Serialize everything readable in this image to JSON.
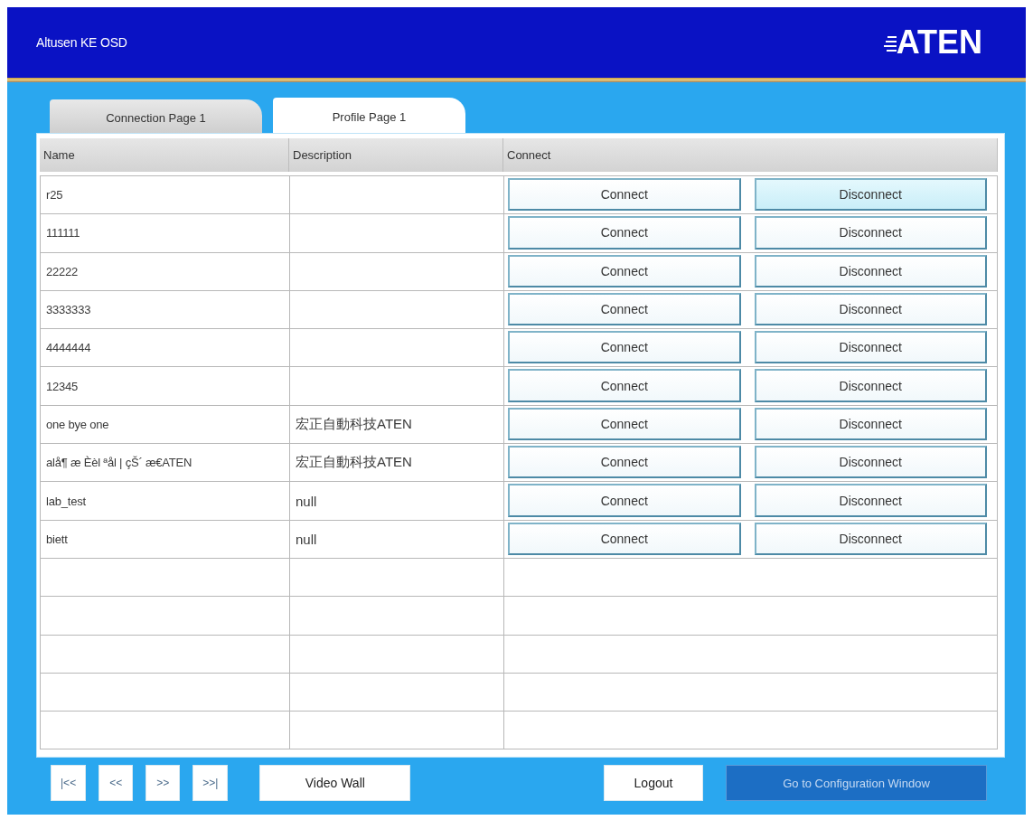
{
  "window": {
    "title": "Altusen KE OSD",
    "logo": "ATEN"
  },
  "tabs": [
    {
      "label": "Connection Page 1",
      "selected": false
    },
    {
      "label": "Profile Page 1",
      "selected": true
    }
  ],
  "table": {
    "columns": [
      "Name",
      "Description",
      "Connect"
    ],
    "rows": [
      {
        "name": "r25",
        "actions": [
          {
            "label": "Connect",
            "highlighted": false
          },
          {
            "label": "Disconnect",
            "highlighted": true
          }
        ]
      },
      {
        "name": "111111",
        "actions": [
          {
            "label": "Connect",
            "highlighted": false
          },
          {
            "label": "Disconnect",
            "highlighted": false
          }
        ]
      },
      {
        "name": "22222",
        "actions": [
          {
            "label": "Connect",
            "highlighted": false
          },
          {
            "label": "Disconnect",
            "highlighted": false
          }
        ]
      },
      {
        "name": "3333333",
        "actions": [
          {
            "label": "Connect",
            "highlighted": false
          },
          {
            "label": "Disconnect",
            "highlighted": false
          }
        ]
      },
      {
        "name": "4444444",
        "actions": [
          {
            "label": "Connect",
            "highlighted": false
          },
          {
            "label": "Disconnect",
            "highlighted": false
          }
        ]
      },
      {
        "name": "12345",
        "actions": [
          {
            "label": "Connect",
            "highlighted": false
          },
          {
            "label": "Disconnect",
            "highlighted": false
          }
        ]
      },
      {
        "name": "one bye one",
        "description": "宏正自動科技ATEN",
        "actions": [
          {
            "label": "Connect",
            "highlighted": false
          },
          {
            "label": "Disconnect",
            "highlighted": false
          }
        ]
      },
      {
        "name": "alå¶ æ Èèl ªål | çŠ´ æ€ATEN",
        "description": "宏正自動科技ATEN",
        "actions": [
          {
            "label": "Connect",
            "highlighted": false
          },
          {
            "label": "Disconnect",
            "highlighted": false
          }
        ]
      },
      {
        "name": "lab_test",
        "description": "null",
        "actions": [
          {
            "label": "Connect",
            "highlighted": false
          },
          {
            "label": "Disconnect",
            "highlighted": false
          }
        ]
      },
      {
        "name": "biett",
        "description": "null",
        "actions": [
          {
            "label": "Connect",
            "highlighted": false
          },
          {
            "label": "Disconnect",
            "highlighted": false
          }
        ]
      }
    ]
  },
  "footer": {
    "pager": [
      "|<<",
      "<<",
      ">>",
      ">>|"
    ],
    "left_buttons": [
      {
        "label": "Video Wall",
        "kind": "plain"
      }
    ],
    "right_buttons": [
      {
        "label": "Logout",
        "kind": "plain"
      },
      {
        "label": "Go to Configuration Window",
        "kind": "primary"
      }
    ]
  }
}
